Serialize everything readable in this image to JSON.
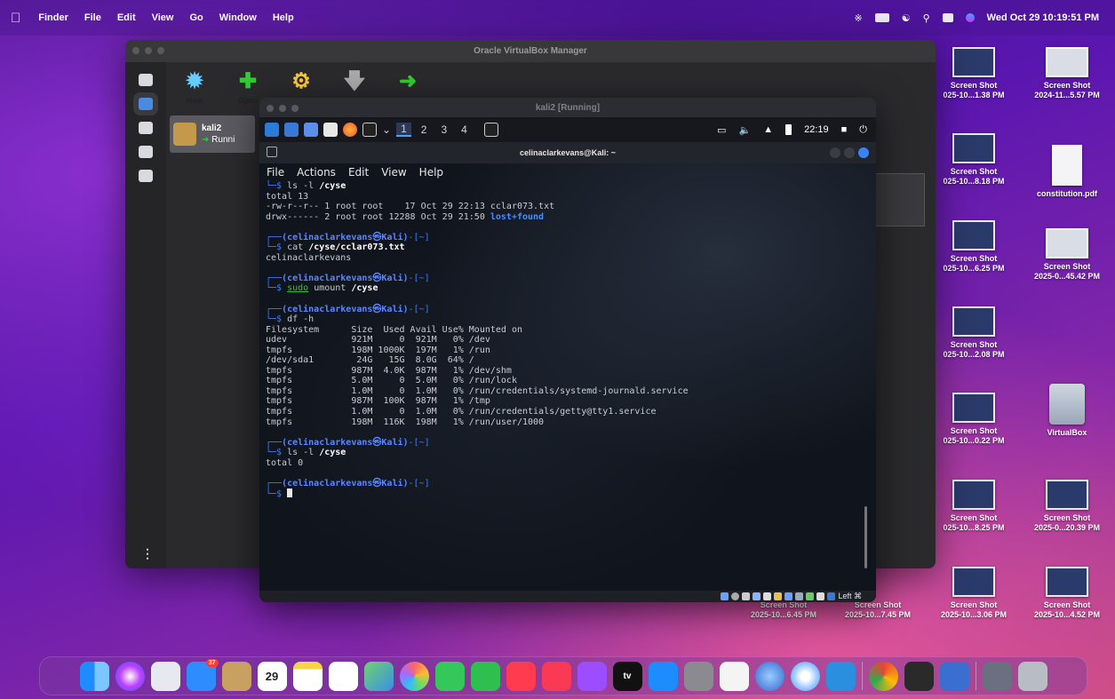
{
  "menubar": {
    "app": "Finder",
    "items": [
      "File",
      "Edit",
      "View",
      "Go",
      "Window",
      "Help"
    ],
    "datetime": "Wed Oct 29  10:19:51 PM"
  },
  "vbox": {
    "title": "Oracle VirtualBox Manager",
    "tools": [
      "New",
      "Open"
    ],
    "vm": {
      "name": "kali2",
      "state": "Runni"
    }
  },
  "kali": {
    "title": "kali2 [Running]",
    "workspaces": [
      "1",
      "2",
      "3",
      "4"
    ],
    "clock": "22:19"
  },
  "terminal": {
    "title": "celinaclarkevans@Kali: ~",
    "menu": [
      "File",
      "Actions",
      "Edit",
      "View",
      "Help"
    ],
    "prompt_user": "(celinaclarkevans㉿Kali)",
    "prompt_dir": "-[~]",
    "line1_cmd": "ls -l ",
    "line1_arg": "/cyse",
    "total1": "total 13",
    "ls_row1": "-rw-r--r-- 1 root root    17 Oct 29 22:13 cclar073.txt",
    "ls_row2_a": "drwx------ 2 root root 12288 Oct 29 21:50 ",
    "ls_row2_b": "lost+found",
    "cat_cmd": "cat ",
    "cat_arg": "/cyse/cclar073.txt",
    "cat_out": "celinaclarkevans",
    "sudo_cmd": "sudo",
    "umount_cmd": " umount ",
    "umount_arg": "/cyse",
    "df_cmd": "df -h",
    "df_header": "Filesystem      Size  Used Avail Use% Mounted on",
    "df_rows": [
      "udev            921M     0  921M   0% /dev",
      "tmpfs           198M 1000K  197M   1% /run",
      "/dev/sda1        24G   15G  8.0G  64% /",
      "tmpfs           987M  4.0K  987M   1% /dev/shm",
      "tmpfs           5.0M     0  5.0M   0% /run/lock",
      "tmpfs           1.0M     0  1.0M   0% /run/credentials/systemd-journald.service",
      "tmpfs           987M  100K  987M   1% /tmp",
      "tmpfs           1.0M     0  1.0M   0% /run/credentials/getty@tty1.service",
      "tmpfs           198M  116K  198M   1% /run/user/1000"
    ],
    "ls2_cmd": "ls -l ",
    "ls2_arg": "/cyse",
    "total2": "total 0",
    "status_right": "Left ⌘"
  },
  "desktop": [
    {
      "name": "Screen Shot",
      "sub": "025-10...1.38 PM"
    },
    {
      "name": "Screen Shot",
      "sub": "2024-11...5.57 PM"
    },
    {
      "name": "Screen Shot",
      "sub": "025-10...8.18 PM"
    },
    {
      "name": "constitution.pdf",
      "sub": ""
    },
    {
      "name": "Screen Shot",
      "sub": "025-10...6.25 PM"
    },
    {
      "name": "Screen Shot",
      "sub": "2025-0...45.42 PM"
    },
    {
      "name": "Screen Shot",
      "sub": "025-10...2.08 PM"
    },
    {
      "name": "Screen Shot",
      "sub": "025-10...0.22 PM"
    },
    {
      "name": "VirtualBox",
      "sub": ""
    },
    {
      "name": "Screen Shot",
      "sub": "025-10...8.25 PM"
    },
    {
      "name": "Screen Shot",
      "sub": "2025-0...20.39 PM"
    },
    {
      "name": "Screen Shot",
      "sub": "2025-10...6.45 PM"
    },
    {
      "name": "Screen Shot",
      "sub": "2025-10...7.45 PM"
    },
    {
      "name": "Screen Shot",
      "sub": "2025-10...3.06 PM"
    },
    {
      "name": "Screen Shot",
      "sub": "2025-10...4.52 PM"
    }
  ],
  "dock": {
    "mail_badge": "37",
    "calendar_day": "29",
    "appletv_label": "tv"
  },
  "colors": {
    "accent": "#3f7cf0",
    "prompt_user": "#5b86ff",
    "terminal_bg": "#10141c"
  }
}
